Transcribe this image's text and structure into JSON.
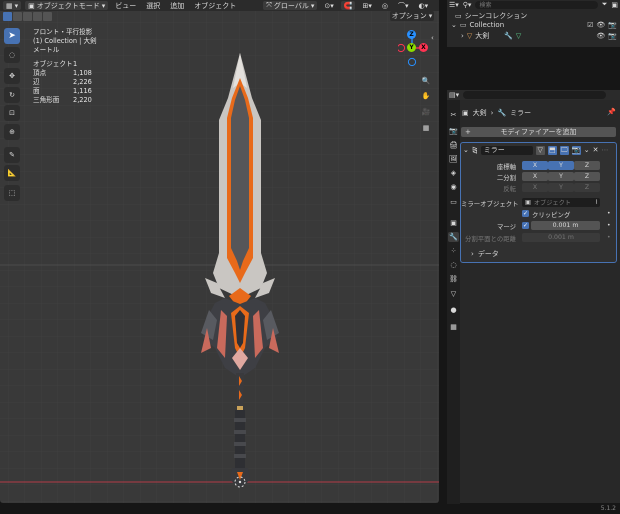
{
  "header": {
    "mode_label": "オブジェクトモード",
    "menu": [
      "ビュー",
      "選択",
      "追加",
      "オブジェクト"
    ],
    "transform_label": "グローバル",
    "options_label": "オプション"
  },
  "overlay": {
    "view_name": "フロント・平行投影",
    "collection_line": "(1) Collection | 大剣",
    "units": "メートル",
    "stats": [
      {
        "label": "オブジェクト",
        "value": "1"
      },
      {
        "label": "頂点",
        "value": "1,108"
      },
      {
        "label": "辺",
        "value": "2,226"
      },
      {
        "label": "面",
        "value": "1,116"
      },
      {
        "label": "三角形面",
        "value": "2,220"
      }
    ]
  },
  "gizmo": {
    "x": "X",
    "y": "Y",
    "z": "Z"
  },
  "outliner": {
    "search_placeholder": "検索",
    "scene_collection": "シーンコレクション",
    "collection": "Collection",
    "object": "大剣"
  },
  "properties": {
    "breadcrumb_object": "大剣",
    "breadcrumb_modifier": "ミラー",
    "add_modifier": "モディファイアーを追加",
    "modifier_name": "ミラー",
    "axis_label": "座標軸",
    "bisect_label": "二分割",
    "flip_label": "反転",
    "axes": [
      "X",
      "Y",
      "Z"
    ],
    "axis_active": [
      true,
      true,
      false
    ],
    "bisect_active": [
      false,
      false,
      false
    ],
    "flip_active": [
      false,
      false,
      false
    ],
    "mirror_object_label": "ミラーオブジェクト",
    "mirror_object_placeholder": "オブジェクト",
    "clipping_label": "クリッピング",
    "clipping_checked": true,
    "merge_label": "マージ",
    "merge_checked": true,
    "merge_value": "0.001 m",
    "bisect_distance_label": "分割平面との距離",
    "bisect_distance_value": "0.001 m",
    "data_panel": "データ"
  },
  "status": {
    "version": "5.1.2"
  },
  "colors": {
    "accent": "#4772b3",
    "axis_x": "#ff3352",
    "axis_y": "#8bdc00",
    "axis_z": "#2890ff",
    "sword_orange": "#e86a1a"
  }
}
